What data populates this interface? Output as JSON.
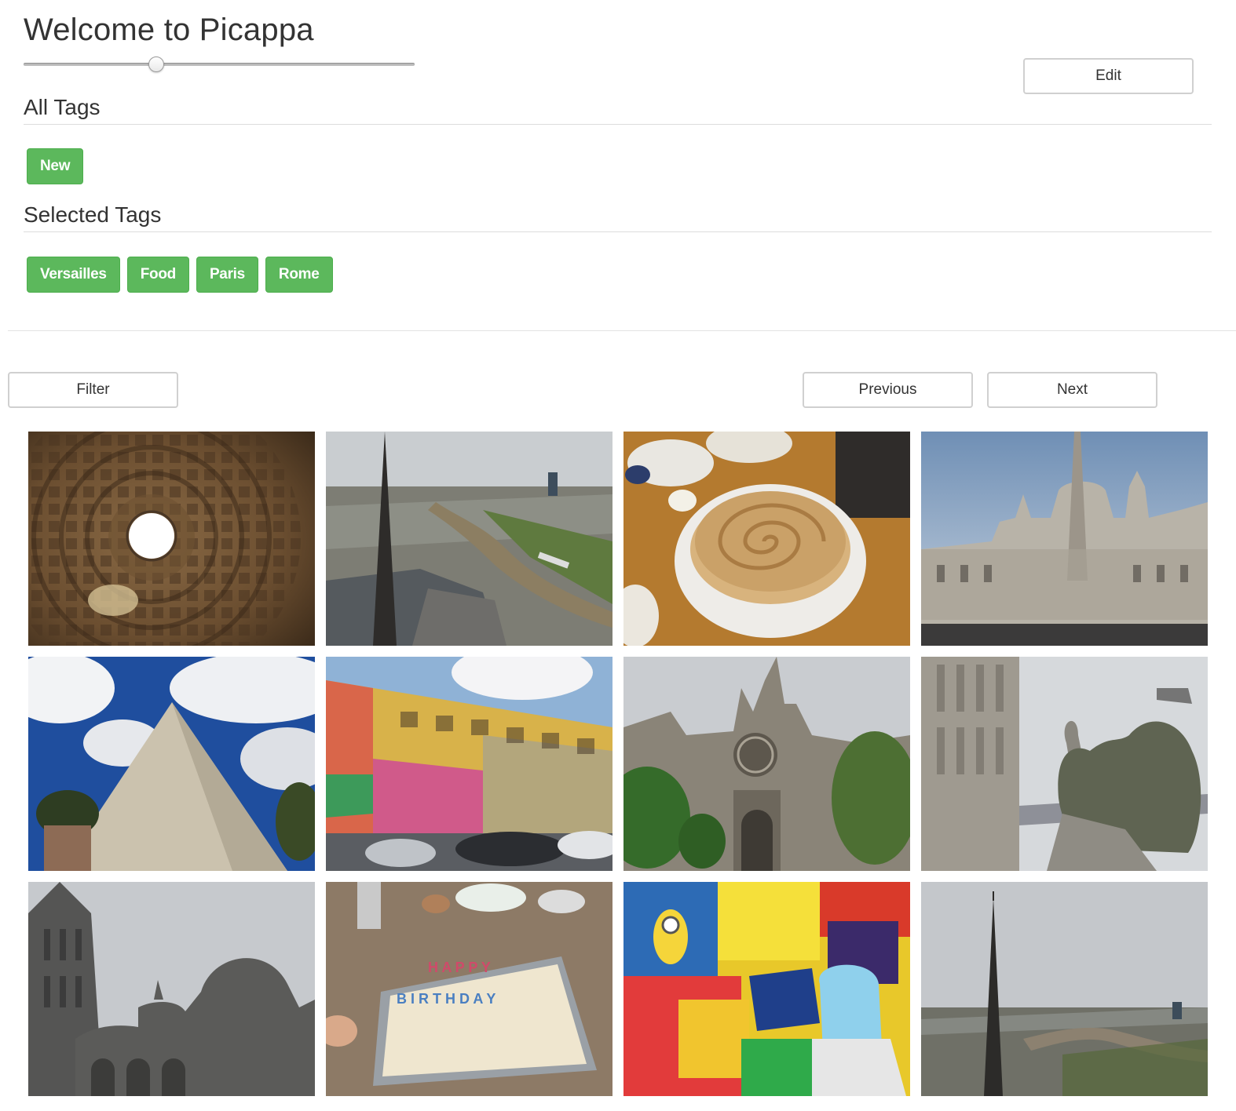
{
  "header": {
    "title": "Welcome to Picappa",
    "zoom_slider_level": 0.34,
    "edit_label": "Edit"
  },
  "all_tags": {
    "heading": "All Tags",
    "tags": [
      "New"
    ]
  },
  "selected_tags": {
    "heading": "Selected Tags",
    "tags": [
      "Versailles",
      "Food",
      "Paris",
      "Rome"
    ]
  },
  "controls": {
    "filter_label": "Filter",
    "previous_label": "Previous",
    "next_label": "Next"
  },
  "colors": {
    "tag_green": "#5cb85c",
    "tag_border": "#4cae4c",
    "button_border": "#d0d0d0",
    "text": "#333333"
  },
  "gallery": {
    "photos": [
      {
        "name": "pantheon-dome-photo"
      },
      {
        "name": "notre-dame-spire-seine-photo"
      },
      {
        "name": "pancake-plate-photo"
      },
      {
        "name": "piazza-navona-church-photo"
      },
      {
        "name": "pyramid-of-cestius-photo"
      },
      {
        "name": "painted-building-photo"
      },
      {
        "name": "notre-dame-facade-photo"
      },
      {
        "name": "gargoyles-photo"
      },
      {
        "name": "sacre-coeur-photo"
      },
      {
        "name": "birthday-cake-photo"
      },
      {
        "name": "ice-cream-display-photo"
      },
      {
        "name": "paris-aerial-spire-photo"
      }
    ]
  }
}
